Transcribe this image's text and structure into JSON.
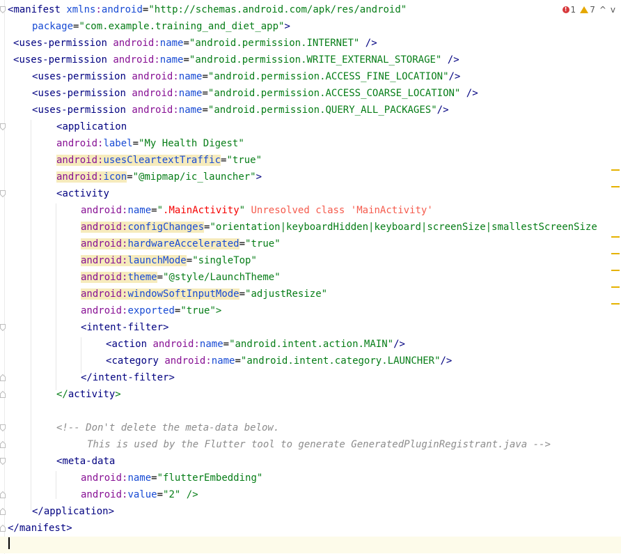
{
  "status": {
    "errors": "1",
    "warnings": "7",
    "prev": "^",
    "next": "v"
  },
  "code": {
    "l1": {
      "lt": "<",
      "tag": "manifest",
      "ns": "xmlns",
      "colon": ":",
      "attr": "android",
      "eq": "=",
      "val": "\"http://schemas.android.com/apk/res/android\""
    },
    "l2": {
      "attr": "package",
      "eq": "=",
      "val": "\"com.example.training_and_diet_app\"",
      "close": ">"
    },
    "l3": {
      "lt": "<",
      "tag": "uses-permission",
      "ns": "android",
      "colon": ":",
      "attr": "name",
      "eq": "=",
      "val": "\"android.permission.INTERNET\"",
      "close": " />"
    },
    "l4": {
      "lt": "<",
      "tag": "uses-permission",
      "ns": "android",
      "colon": ":",
      "attr": "name",
      "eq": "=",
      "val": "\"android.permission.WRITE_EXTERNAL_STORAGE\"",
      "close": " />"
    },
    "l5": {
      "lt": "<",
      "tag": "uses-permission",
      "ns": "android",
      "colon": ":",
      "attr": "name",
      "eq": "=",
      "val": "\"android.permission.ACCESS_FINE_LOCATION\"",
      "close": "/>"
    },
    "l6": {
      "lt": "<",
      "tag": "uses-permission",
      "ns": "android",
      "colon": ":",
      "attr": "name",
      "eq": "=",
      "val": "\"android.permission.ACCESS_COARSE_LOCATION\"",
      "close": " />"
    },
    "l7": {
      "lt": "<",
      "tag": "uses-permission",
      "ns": "android",
      "colon": ":",
      "attr": "name",
      "eq": "=",
      "val": "\"android.permission.QUERY_ALL_PACKAGES\"",
      "close": "/>"
    },
    "l8": {
      "lt": "<",
      "tag": "application"
    },
    "l9": {
      "ns": "android",
      "colon": ":",
      "attr": "label",
      "eq": "=",
      "val": "\"My Health Digest\""
    },
    "l10": {
      "ns": "android",
      "colon": ":",
      "attr": "usesCleartextTraffic",
      "eq": "=",
      "val": "\"true\""
    },
    "l11": {
      "ns": "android",
      "colon": ":",
      "attr": "icon",
      "eq": "=",
      "val": "\"@mipmap/ic_launcher\"",
      "close": ">"
    },
    "l12": {
      "lt": "<",
      "tag": "activity"
    },
    "l13": {
      "ns": "android",
      "colon": ":",
      "attr": "name",
      "eq": "=",
      "q1": "\"",
      "red": ".MainActivity",
      "q2": "\"",
      "warn": " Unresolved class 'MainActivity'"
    },
    "l14": {
      "ns": "android",
      "colon": ":",
      "attr": "configChanges",
      "eq": "=",
      "val": "\"orientation|keyboardHidden|keyboard|screenSize|smallestScreenSize"
    },
    "l15": {
      "ns": "android",
      "colon": ":",
      "attr": "hardwareAccelerated",
      "eq": "=",
      "val": "\"true\""
    },
    "l16": {
      "ns": "android",
      "colon": ":",
      "attr": "launchMode",
      "eq": "=",
      "val": "\"singleTop\""
    },
    "l17": {
      "ns": "android",
      "colon": ":",
      "attr": "theme",
      "eq": "=",
      "val": "\"@style/LaunchTheme\""
    },
    "l18": {
      "ns": "android",
      "colon": ":",
      "attr": "windowSoftInputMode",
      "eq": "=",
      "val": "\"adjustResize\""
    },
    "l19": {
      "ns": "android",
      "colon": ":",
      "attr": "exported",
      "eq": "=",
      "val": "\"true\"",
      "close": ">"
    },
    "l20": {
      "lt": "<",
      "tag": "intent-filter",
      "close": ">"
    },
    "l21": {
      "lt": "<",
      "tag": "action",
      "ns": "android",
      "colon": ":",
      "attr": "name",
      "eq": "=",
      "val": "\"android.intent.action.MAIN\"",
      "close": "/>"
    },
    "l22": {
      "lt": "<",
      "tag": "category",
      "ns": "android",
      "colon": ":",
      "attr": "name",
      "eq": "=",
      "val": "\"android.intent.category.LAUNCHER\"",
      "close": "/>"
    },
    "l23": {
      "lt": "</",
      "tag": "intent-filter",
      "close": ">"
    },
    "l24": {
      "lt": "</",
      "tag": "activity",
      "close": ">"
    },
    "l26": {
      "comment": "<!-- Don't delete the meta-data below."
    },
    "l27": {
      "comment": "This is used by the Flutter tool to generate GeneratedPluginRegistrant.java -->"
    },
    "l28": {
      "lt": "<",
      "tag": "meta-data"
    },
    "l29": {
      "ns": "android",
      "colon": ":",
      "attr": "name",
      "eq": "=",
      "val": "\"flutterEmbedding\""
    },
    "l30": {
      "ns": "android",
      "colon": ":",
      "attr": "value",
      "eq": "=",
      "val": "\"2\"",
      "close": " />"
    },
    "l31": {
      "lt": "</",
      "tag": "application",
      "close": ">"
    },
    "l32": {
      "lt": "</",
      "tag": "manifest",
      "close": ">"
    }
  }
}
